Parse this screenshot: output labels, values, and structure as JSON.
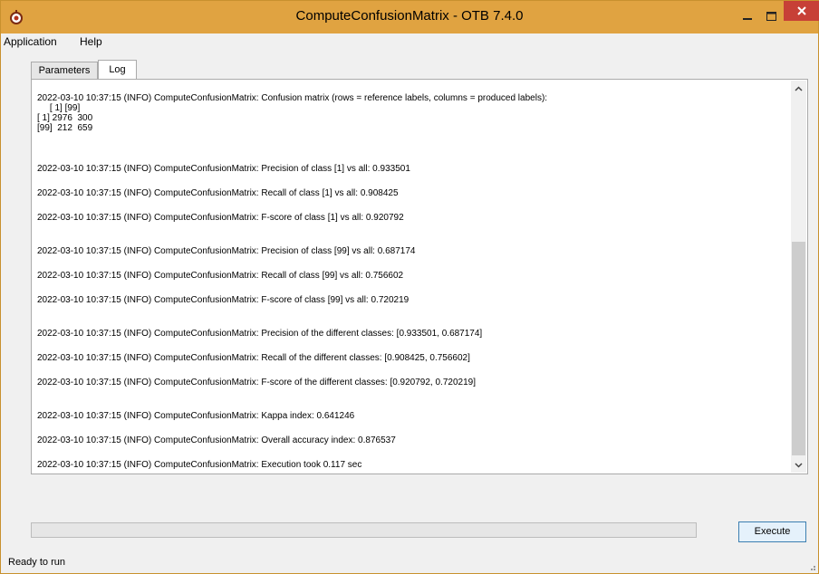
{
  "window": {
    "title": "ComputeConfusionMatrix - OTB 7.4.0",
    "icons": [
      "app-icon",
      "minimize-icon",
      "maximize-icon",
      "close-icon"
    ],
    "title_color": "#e0a341",
    "close_color": "#c74037"
  },
  "menu": {
    "application": "Application",
    "help": "Help"
  },
  "tabs": {
    "parameters": "Parameters",
    "log": "Log",
    "active": "Log"
  },
  "log": {
    "lines": [
      "2022-03-10 10:37:15 (INFO) ComputeConfusionMatrix: Confusion matrix (rows = reference labels, columns = produced labels):",
      "     [ 1] [99]",
      "[ 1] 2976  300",
      "[99]  212  659",
      "2022-03-10 10:37:15 (INFO) ComputeConfusionMatrix: Precision of class [1] vs all: 0.933501",
      "2022-03-10 10:37:15 (INFO) ComputeConfusionMatrix: Recall of class [1] vs all: 0.908425",
      "2022-03-10 10:37:15 (INFO) ComputeConfusionMatrix: F-score of class [1] vs all: 0.920792",
      "2022-03-10 10:37:15 (INFO) ComputeConfusionMatrix: Precision of class [99] vs all: 0.687174",
      "2022-03-10 10:37:15 (INFO) ComputeConfusionMatrix: Recall of class [99] vs all: 0.756602",
      "2022-03-10 10:37:15 (INFO) ComputeConfusionMatrix: F-score of class [99] vs all: 0.720219",
      "2022-03-10 10:37:15 (INFO) ComputeConfusionMatrix: Precision of the different classes: [0.933501, 0.687174]",
      "2022-03-10 10:37:15 (INFO) ComputeConfusionMatrix: Recall of the different classes: [0.908425, 0.756602]",
      "2022-03-10 10:37:15 (INFO) ComputeConfusionMatrix: F-score of the different classes: [0.920792, 0.720219]",
      "2022-03-10 10:37:15 (INFO) ComputeConfusionMatrix: Kappa index: 0.641246",
      "2022-03-10 10:37:15 (INFO) ComputeConfusionMatrix: Overall accuracy index: 0.876537",
      "2022-03-10 10:37:15 (INFO) ComputeConfusionMatrix: Execution took 0.117 sec"
    ]
  },
  "execute": {
    "label": "Execute"
  },
  "progress": {
    "value": 0
  },
  "status": {
    "text": "Ready to run"
  }
}
